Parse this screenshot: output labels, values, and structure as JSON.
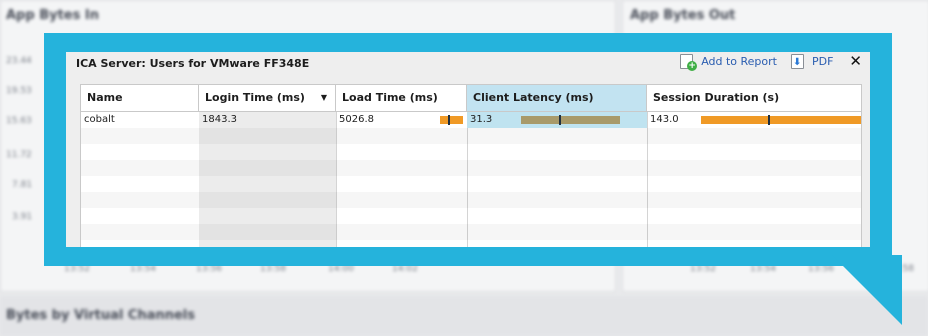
{
  "background": {
    "panel_left_title": "App Bytes In",
    "panel_right_title": "App Bytes Out",
    "bottom_title": "Bytes by Virtual Channels",
    "y_ticks": [
      "23.44",
      "19.53",
      "15.63",
      "11.72",
      "7.81",
      "3.91"
    ],
    "x_ticks_left": [
      "13:52",
      "13:54",
      "13:56",
      "13:58",
      "14:00",
      "14:02"
    ],
    "x_ticks_right": [
      "13:52",
      "13:54",
      "13:56",
      "13:58"
    ]
  },
  "popup": {
    "title": "ICA Server: Users for VMware FF348E",
    "add_to_report_label": "Add to Report",
    "pdf_label": "PDF",
    "close_label": "✕",
    "columns": [
      {
        "label": "Name"
      },
      {
        "label": "Login Time (ms)",
        "sort": "▼"
      },
      {
        "label": "Load Time (ms)"
      },
      {
        "label": "Client Latency (ms)"
      },
      {
        "label": "Session Duration (s)"
      }
    ],
    "rows": [
      {
        "name": "cobalt",
        "login_time": "1843.3",
        "load_time": "5026.8",
        "client_latency": "31.3",
        "session_duration": "143.0"
      }
    ],
    "bar_levels": {
      "login_time": 0.01,
      "load_time": 0.85,
      "client_latency": 0.8,
      "session_duration": 1.0
    },
    "bar_markers": {
      "load_time": 0.3,
      "client_latency": 0.31,
      "session_duration": 0.42
    }
  },
  "colors": {
    "accent": "#25b3dc",
    "bar_orange": "#f09a26",
    "bar_olive": "#a89a6a",
    "selected_column": "#c2e3f1"
  }
}
